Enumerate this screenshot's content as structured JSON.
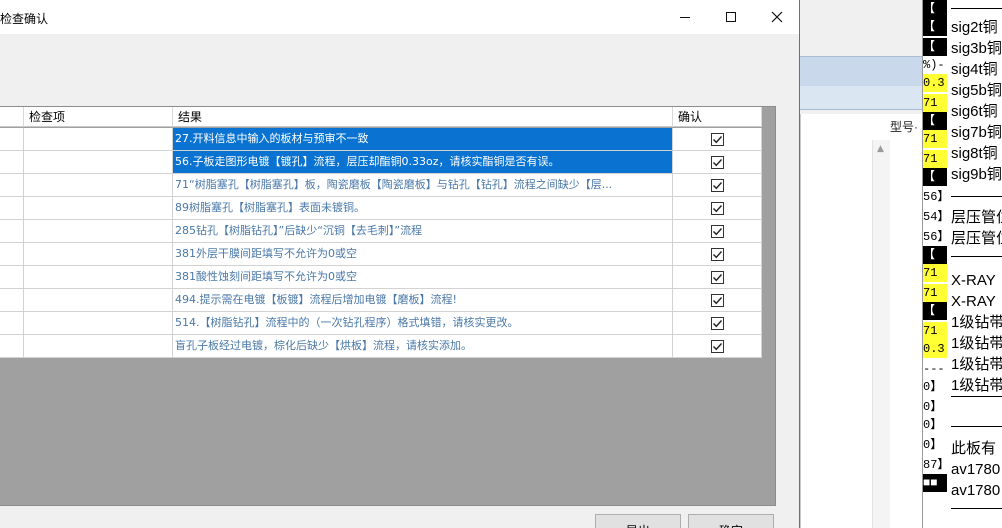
{
  "dialog": {
    "title": "检查确认",
    "columns": [
      "检查项",
      "结果",
      "确认"
    ],
    "rows": [
      {
        "result": "27.开料信息中输入的板材与预审不一致",
        "confirmed": true,
        "selected": true
      },
      {
        "result": "56.子板走图形电镀【镀孔】流程，层压却酯铜0.33oz，请核实酯铜是否有误。",
        "confirmed": true,
        "selected": true
      },
      {
        "result": "71“树脂塞孔【树脂塞孔】板，陶瓷磨板【陶瓷磨板】与钻孔【钻孔】流程之间缺少【层...",
        "confirmed": true,
        "selected": false
      },
      {
        "result": "89树脂塞孔【树脂塞孔】表面未镀铜。",
        "confirmed": true,
        "selected": false
      },
      {
        "result": "285钻孔【树脂钻孔】”后缺少“沉铜【去毛刺】”流程",
        "confirmed": true,
        "selected": false
      },
      {
        "result": "381外层干膜间距填写不允许为0或空",
        "confirmed": true,
        "selected": false
      },
      {
        "result": "381酸性蚀刻间距填写不允许为0或空",
        "confirmed": true,
        "selected": false
      },
      {
        "result": "494.提示需在电镀【板镀】流程后增加电镀【磨板】流程!",
        "confirmed": true,
        "selected": false
      },
      {
        "result": "514.【树脂钻孔】流程中的（一次钻孔程序）格式填错，请核实更改。",
        "confirmed": true,
        "selected": false
      },
      {
        "result": "盲孔子板经过电镀，棕化后缺少【烘板】流程，请核实添加。",
        "confirmed": true,
        "selected": false
      }
    ],
    "buttons": {
      "export": "导出",
      "ok": "确定"
    }
  },
  "background_app": {
    "column_header": "型号·",
    "right_lines": [
      "sig2t铜",
      "sig3b铜",
      "sig4t铜",
      "sig5b铜",
      "sig6t铜",
      "sig7b铜",
      "sig8t铜",
      "sig9b铜",
      "层压管位",
      "层压管位",
      "X-RAY",
      "X-RAY",
      "1级钻带",
      "1级钻带",
      "1级钻带",
      "1级钻带",
      "此板有",
      "av1780",
      "av1780"
    ],
    "gutter_marks": [
      "【",
      "【",
      "【",
      "%)-",
      "0.3",
      "71",
      "【",
      "71",
      "71",
      "【",
      "56】",
      "54】",
      "56】",
      "【",
      "71",
      "71",
      "【",
      "71",
      "0.3",
      "---",
      "0】",
      "0】",
      "0】",
      "0】",
      "87】",
      "■■"
    ],
    "colors": {
      "highlight": "#ffff33"
    }
  },
  "colors": {
    "selection": "#0a73d1",
    "result_text": "#4a78a8",
    "grid_background": "#a0a0a0"
  }
}
